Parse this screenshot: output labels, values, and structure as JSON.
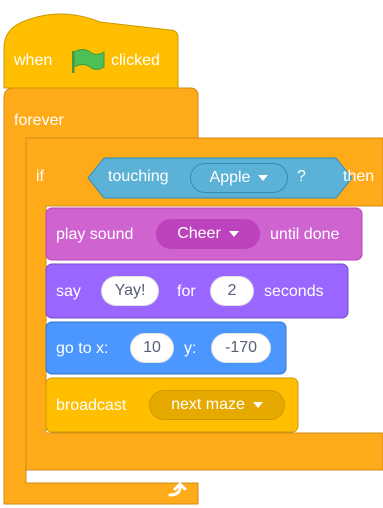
{
  "event_block": {
    "when": "when",
    "clicked": "clicked",
    "flag_icon": "green-flag-icon"
  },
  "forever_block": {
    "label": "forever",
    "loop_icon": "loop-arrow-icon"
  },
  "if_block": {
    "if_label": "if",
    "then_label": "then",
    "condition": {
      "label": "touching",
      "dropdown": "Apple",
      "question": "?"
    }
  },
  "play_sound_block": {
    "label": "play sound",
    "dropdown": "Cheer",
    "suffix": "until done"
  },
  "say_block": {
    "label": "say",
    "message": "Yay!",
    "for_label": "for",
    "duration": "2",
    "seconds_label": "seconds"
  },
  "goto_block": {
    "label": "go to x:",
    "x": "10",
    "y_label": "y:",
    "y": "-170"
  },
  "broadcast_block": {
    "label": "broadcast",
    "dropdown": "next maze"
  },
  "colors": {
    "events": "#FFBF00",
    "control": "#FFAB19",
    "sensing": "#5CB1D6",
    "sound": "#CF63CF",
    "looks": "#9966FF",
    "motion": "#4C97FF"
  }
}
